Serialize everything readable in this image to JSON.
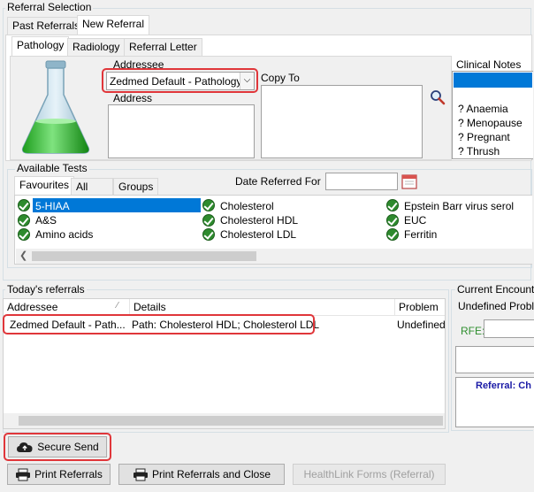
{
  "referral_selection": {
    "legend": "Referral Selection",
    "tabs": [
      "Past Referrals",
      "New Referral"
    ],
    "subtabs": [
      "Pathology",
      "Radiology",
      "Referral Letter"
    ],
    "addressee_label": "Addressee",
    "addressee_value": "Zedmed Default  - Pathology",
    "address_label": "Address",
    "copy_to_label": "Copy To",
    "clinical_notes_label": "Clinical Notes",
    "clinical_notes": [
      "? Anaemia",
      "? Menopause",
      "? Pregnant",
      "? Thrush"
    ]
  },
  "available_tests": {
    "legend": "Available Tests",
    "tabs": [
      "Favourites",
      "All",
      "Groups"
    ],
    "date_label": "Date Referred For",
    "date_value": "",
    "columns": [
      [
        "5-HIAA",
        "A&S",
        "Amino acids"
      ],
      [
        "Cholesterol",
        "Cholesterol HDL",
        "Cholesterol LDL"
      ],
      [
        "Epstein Barr virus serol",
        "EUC",
        "Ferritin"
      ]
    ]
  },
  "todays_referrals": {
    "legend": "Today's referrals",
    "headers": [
      "Addressee",
      "Details",
      "Problem"
    ],
    "rows": [
      {
        "addressee": "Zedmed Default  - Path...",
        "details": "Path: Cholesterol HDL; Cholesterol LDL",
        "problem": "Undefined"
      }
    ]
  },
  "current_encounter": {
    "legend": "Current Encount",
    "problem_label": "Undefined Probl",
    "rfe_label": "RFE:",
    "referral_text": "Referral: Ch"
  },
  "buttons": {
    "secure_send": "Secure Send",
    "print_referrals": "Print Referrals",
    "print_close": "Print Referrals and Close",
    "healthlink": "HealthLink Forms (Referral)"
  },
  "colors": {
    "highlight": "#0078d7",
    "annotation_red": "#e0363a",
    "check_green": "#2e8b2e",
    "referral_text_blue": "#1a1aa6"
  }
}
